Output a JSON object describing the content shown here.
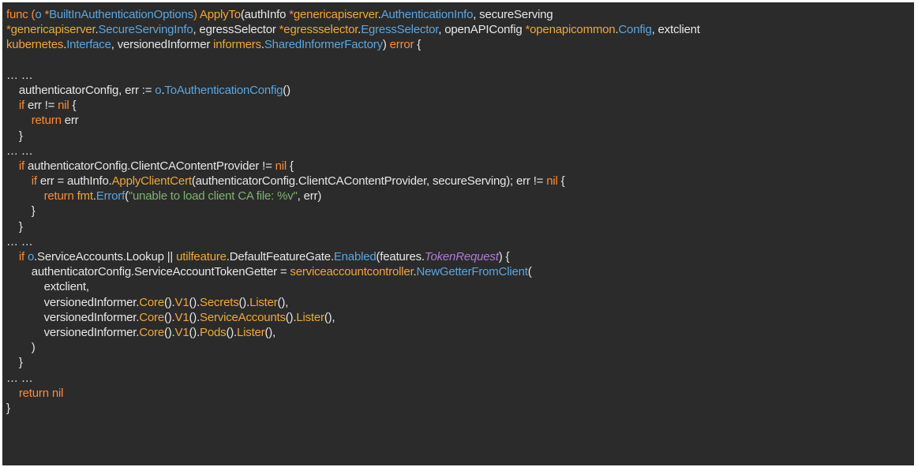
{
  "colors": {
    "background": "#2b2b2b",
    "keyword": "#ff8c2e",
    "type": "#5aa6e0",
    "method": "#f0a830",
    "string": "#7fb36e",
    "italic_field": "#b07ad8",
    "text": "#e6e6e6"
  },
  "code": {
    "lines": [
      [
        {
          "c": "kw",
          "t": "func ("
        },
        {
          "c": "type",
          "t": "o "
        },
        {
          "c": "kw",
          "t": "*"
        },
        {
          "c": "type",
          "t": "BuiltInAuthenticationOptions"
        },
        {
          "c": "kw",
          "t": ") "
        },
        {
          "c": "method",
          "t": "ApplyTo"
        },
        {
          "c": "plain",
          "t": "(authInfo "
        },
        {
          "c": "kw",
          "t": "*"
        },
        {
          "c": "method",
          "t": "genericapiserver"
        },
        {
          "c": "plain",
          "t": "."
        },
        {
          "c": "type",
          "t": "AuthenticationInfo"
        },
        {
          "c": "plain",
          "t": ", secureServing"
        }
      ],
      [
        {
          "c": "kw",
          "t": "*"
        },
        {
          "c": "method",
          "t": "genericapiserver"
        },
        {
          "c": "plain",
          "t": "."
        },
        {
          "c": "type",
          "t": "SecureServingInfo"
        },
        {
          "c": "plain",
          "t": ", egressSelector "
        },
        {
          "c": "kw",
          "t": "*"
        },
        {
          "c": "method",
          "t": "egressselector"
        },
        {
          "c": "plain",
          "t": "."
        },
        {
          "c": "type",
          "t": "EgressSelector"
        },
        {
          "c": "plain",
          "t": ", openAPIConfig "
        },
        {
          "c": "kw",
          "t": "*"
        },
        {
          "c": "method",
          "t": "openapicommon"
        },
        {
          "c": "plain",
          "t": "."
        },
        {
          "c": "type",
          "t": "Config"
        },
        {
          "c": "plain",
          "t": ", extclient"
        }
      ],
      [
        {
          "c": "method",
          "t": "kubernetes"
        },
        {
          "c": "plain",
          "t": "."
        },
        {
          "c": "type",
          "t": "Interface"
        },
        {
          "c": "plain",
          "t": ", versionedInformer "
        },
        {
          "c": "method",
          "t": "informers"
        },
        {
          "c": "plain",
          "t": "."
        },
        {
          "c": "type",
          "t": "SharedInformerFactory"
        },
        {
          "c": "plain",
          "t": ") "
        },
        {
          "c": "kw",
          "t": "error"
        },
        {
          "c": "plain",
          "t": " {"
        }
      ],
      [],
      [
        {
          "c": "plain",
          "t": "… …"
        }
      ],
      [
        {
          "c": "plain",
          "t": "    authenticatorConfig, err := "
        },
        {
          "c": "type",
          "t": "o"
        },
        {
          "c": "plain",
          "t": "."
        },
        {
          "c": "type",
          "t": "ToAuthenticationConfig"
        },
        {
          "c": "plain",
          "t": "()"
        }
      ],
      [
        {
          "c": "kw",
          "t": "    if "
        },
        {
          "c": "plain",
          "t": "err != "
        },
        {
          "c": "kw",
          "t": "nil"
        },
        {
          "c": "plain",
          "t": " {"
        }
      ],
      [
        {
          "c": "kw",
          "t": "        return "
        },
        {
          "c": "plain",
          "t": "err"
        }
      ],
      [
        {
          "c": "plain",
          "t": "    }"
        }
      ],
      [
        {
          "c": "plain",
          "t": "… …"
        }
      ],
      [
        {
          "c": "kw",
          "t": "    if "
        },
        {
          "c": "plain",
          "t": "authenticatorConfig.ClientCAContentProvider != "
        },
        {
          "c": "kw",
          "t": "nil"
        },
        {
          "c": "plain",
          "t": " {"
        }
      ],
      [
        {
          "c": "kw",
          "t": "        if "
        },
        {
          "c": "plain",
          "t": "err = authInfo."
        },
        {
          "c": "method",
          "t": "ApplyClientCert"
        },
        {
          "c": "plain",
          "t": "(authenticatorConfig.ClientCAContentProvider, secureServing); err != "
        },
        {
          "c": "kw",
          "t": "nil"
        },
        {
          "c": "plain",
          "t": " {"
        }
      ],
      [
        {
          "c": "kw",
          "t": "            return "
        },
        {
          "c": "method",
          "t": "fmt"
        },
        {
          "c": "plain",
          "t": "."
        },
        {
          "c": "type",
          "t": "Errorf"
        },
        {
          "c": "plain",
          "t": "("
        },
        {
          "c": "str",
          "t": "\"unable to load client CA file: %v\""
        },
        {
          "c": "plain",
          "t": ", err)"
        }
      ],
      [
        {
          "c": "plain",
          "t": "        }"
        }
      ],
      [
        {
          "c": "plain",
          "t": "    }"
        }
      ],
      [
        {
          "c": "plain",
          "t": "… …"
        }
      ],
      [
        {
          "c": "kw",
          "t": "    if "
        },
        {
          "c": "type",
          "t": "o"
        },
        {
          "c": "plain",
          "t": ".ServiceAccounts.Lookup || "
        },
        {
          "c": "method",
          "t": "utilfeature"
        },
        {
          "c": "plain",
          "t": ".DefaultFeatureGate."
        },
        {
          "c": "type",
          "t": "Enabled"
        },
        {
          "c": "plain",
          "t": "(features."
        },
        {
          "c": "ital",
          "t": "TokenRequest"
        },
        {
          "c": "plain",
          "t": ") {"
        }
      ],
      [
        {
          "c": "plain",
          "t": "        authenticatorConfig.ServiceAccountTokenGetter = "
        },
        {
          "c": "method",
          "t": "serviceaccountcontroller"
        },
        {
          "c": "plain",
          "t": "."
        },
        {
          "c": "type",
          "t": "NewGetterFromClient"
        },
        {
          "c": "plain",
          "t": "("
        }
      ],
      [
        {
          "c": "plain",
          "t": "            extclient,"
        }
      ],
      [
        {
          "c": "plain",
          "t": "            versionedInformer."
        },
        {
          "c": "method",
          "t": "Core"
        },
        {
          "c": "plain",
          "t": "()."
        },
        {
          "c": "method",
          "t": "V1"
        },
        {
          "c": "plain",
          "t": "()."
        },
        {
          "c": "method",
          "t": "Secrets"
        },
        {
          "c": "plain",
          "t": "()."
        },
        {
          "c": "method",
          "t": "Lister"
        },
        {
          "c": "plain",
          "t": "(),"
        }
      ],
      [
        {
          "c": "plain",
          "t": "            versionedInformer."
        },
        {
          "c": "method",
          "t": "Core"
        },
        {
          "c": "plain",
          "t": "()."
        },
        {
          "c": "method",
          "t": "V1"
        },
        {
          "c": "plain",
          "t": "()."
        },
        {
          "c": "method",
          "t": "ServiceAccounts"
        },
        {
          "c": "plain",
          "t": "()."
        },
        {
          "c": "method",
          "t": "Lister"
        },
        {
          "c": "plain",
          "t": "(),"
        }
      ],
      [
        {
          "c": "plain",
          "t": "            versionedInformer."
        },
        {
          "c": "method",
          "t": "Core"
        },
        {
          "c": "plain",
          "t": "()."
        },
        {
          "c": "method",
          "t": "V1"
        },
        {
          "c": "plain",
          "t": "()."
        },
        {
          "c": "method",
          "t": "Pods"
        },
        {
          "c": "plain",
          "t": "()."
        },
        {
          "c": "method",
          "t": "Lister"
        },
        {
          "c": "plain",
          "t": "(),"
        }
      ],
      [
        {
          "c": "plain",
          "t": "        )"
        }
      ],
      [
        {
          "c": "plain",
          "t": "    }"
        }
      ],
      [
        {
          "c": "plain",
          "t": "… …"
        }
      ],
      [
        {
          "c": "kw",
          "t": "    return "
        },
        {
          "c": "kw",
          "t": "nil"
        }
      ],
      [
        {
          "c": "plain",
          "t": "}"
        }
      ]
    ]
  }
}
